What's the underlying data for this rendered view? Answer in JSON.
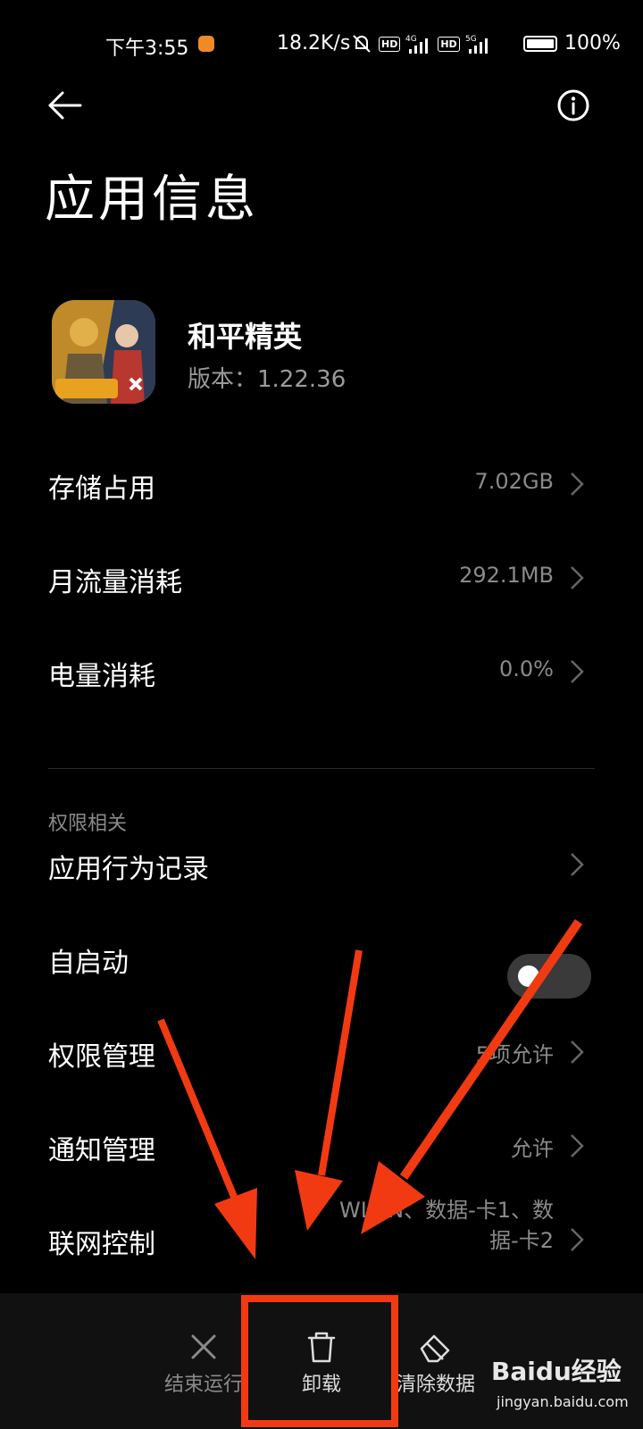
{
  "status_bar": {
    "time": "下午3:55",
    "network_speed": "18.2K/s",
    "battery": "100%",
    "sim1_label": "4G",
    "sim2_label": "5G",
    "hd1": "HD",
    "hd2": "HD"
  },
  "header": {
    "back_icon": "arrow-left-icon",
    "info_icon": "info-circle-icon",
    "title": "应用信息"
  },
  "app": {
    "name": "和平精英",
    "version": "版本：1.22.36",
    "icon": "game-app-icon"
  },
  "usage_rows": [
    {
      "label": "存储占用",
      "value": "7.02GB"
    },
    {
      "label": "月流量消耗",
      "value": "292.1MB"
    },
    {
      "label": "电量消耗",
      "value": "0.0%"
    }
  ],
  "permissions_section": {
    "header": "权限相关",
    "rows": [
      {
        "label": "应用行为记录",
        "value": ""
      },
      {
        "label": "自启动",
        "value": "",
        "toggle_on": false
      },
      {
        "label": "权限管理",
        "value": "5项允许"
      },
      {
        "label": "通知管理",
        "value": "允许"
      },
      {
        "label": "联网控制",
        "value_line1": "WLAN、数据-卡1、数",
        "value_line2": "据-卡2"
      }
    ]
  },
  "bottom_bar": {
    "force_stop": "结束运行",
    "uninstall": "卸载",
    "clear_data": "清除数据"
  },
  "watermark": {
    "brand": "Baidu经验",
    "url": "jingyan.baidu.com"
  },
  "colors": {
    "background": "#000000",
    "bottom_bar": "#111111",
    "secondary_text": "#8a8a8a",
    "annotation_red": "#f23a12"
  }
}
